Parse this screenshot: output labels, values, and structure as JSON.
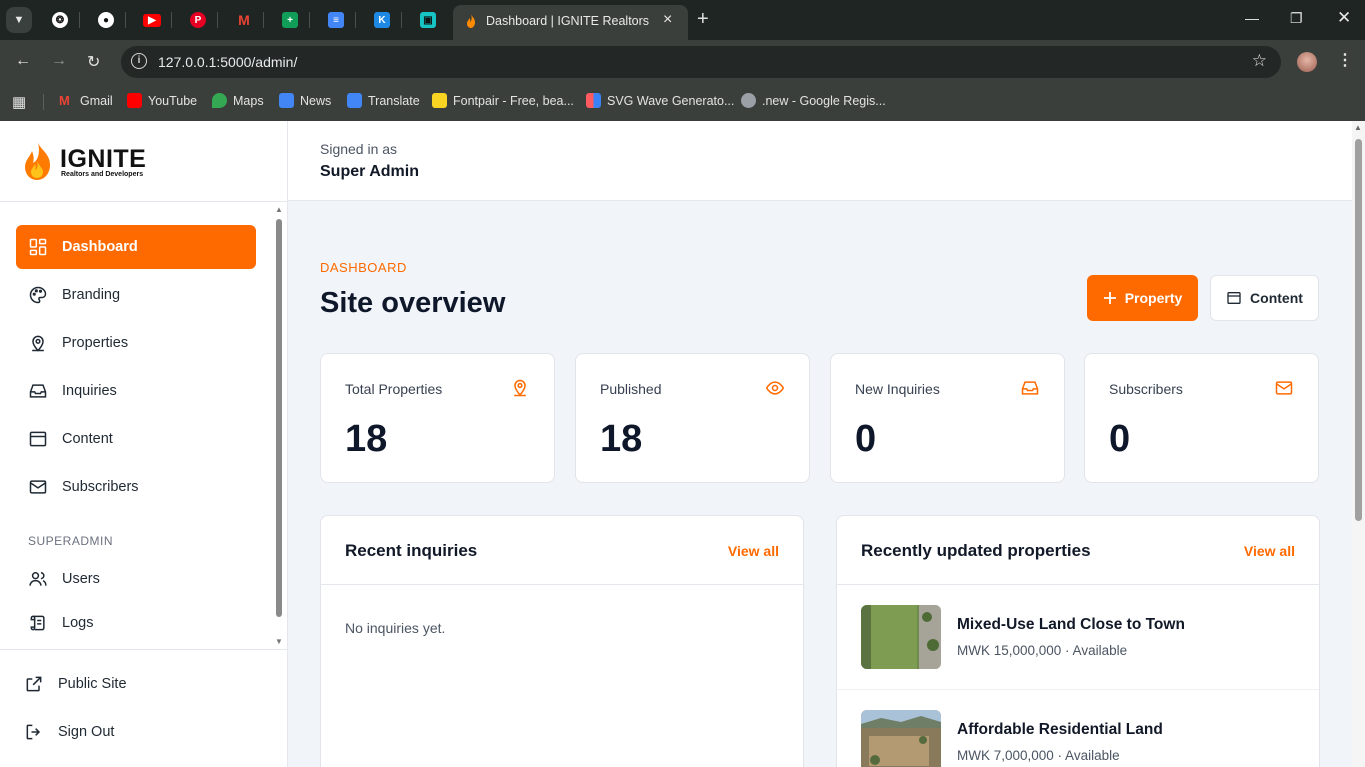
{
  "browser": {
    "active_tab_title": "Dashboard | IGNITE Realtors and Developers",
    "url": "127.0.0.1:5000/admin/",
    "bookmarks": [
      {
        "label": "Gmail",
        "icon": "gmail-icon",
        "color": "#ea4335"
      },
      {
        "label": "YouTube",
        "icon": "youtube-icon",
        "color": "#ff0000"
      },
      {
        "label": "Maps",
        "icon": "maps-icon",
        "color": "#34a853"
      },
      {
        "label": "News",
        "icon": "news-icon",
        "color": "#4285f4"
      },
      {
        "label": "Translate",
        "icon": "translate-icon",
        "color": "#4285f4"
      },
      {
        "label": "Fontpair - Free, bea...",
        "icon": "fontpair-icon",
        "color": "#f9d423"
      },
      {
        "label": "SVG Wave Generato...",
        "icon": "svgwave-icon",
        "color": "#ff5a5f"
      },
      {
        "label": ".new - Google Regis...",
        "icon": "globe-icon",
        "color": "#9aa0a6"
      }
    ]
  },
  "brand": {
    "name": "IGNITE",
    "tagline": "Realtors and Developers",
    "accent": "#ff6a00"
  },
  "sidebar": {
    "items": [
      {
        "label": "Dashboard",
        "icon": "dashboard-grid-icon",
        "active": true
      },
      {
        "label": "Branding",
        "icon": "palette-icon"
      },
      {
        "label": "Properties",
        "icon": "map-pin-icon"
      },
      {
        "label": "Inquiries",
        "icon": "inbox-icon"
      },
      {
        "label": "Content",
        "icon": "layout-icon"
      },
      {
        "label": "Subscribers",
        "icon": "mail-icon"
      }
    ],
    "superadmin_label": "SUPERADMIN",
    "superadmin_items": [
      {
        "label": "Users",
        "icon": "users-icon"
      },
      {
        "label": "Logs",
        "icon": "scroll-icon"
      }
    ],
    "footer_items": [
      {
        "label": "Public Site",
        "icon": "external-link-icon"
      },
      {
        "label": "Sign Out",
        "icon": "sign-out-icon"
      }
    ]
  },
  "header": {
    "signed_in_label": "Signed in as",
    "user_name": "Super Admin"
  },
  "main": {
    "eyebrow": "DASHBOARD",
    "title": "Site overview",
    "property_button": "Property",
    "content_button": "Content",
    "stats": [
      {
        "label": "Total Properties",
        "value": "18",
        "icon": "map-pin-icon"
      },
      {
        "label": "Published",
        "value": "18",
        "icon": "eye-icon"
      },
      {
        "label": "New Inquiries",
        "value": "0",
        "icon": "inbox-icon"
      },
      {
        "label": "Subscribers",
        "value": "0",
        "icon": "mail-icon"
      }
    ],
    "recent_inquiries": {
      "title": "Recent inquiries",
      "view_all": "View all",
      "empty": "No inquiries yet."
    },
    "recent_properties": {
      "title": "Recently updated properties",
      "view_all": "View all",
      "items": [
        {
          "name": "Mixed-Use Land Close to Town",
          "meta": "MWK 15,000,000 · Available"
        },
        {
          "name": "Affordable Residential Land",
          "meta": "MWK 7,000,000 · Available"
        }
      ]
    }
  }
}
